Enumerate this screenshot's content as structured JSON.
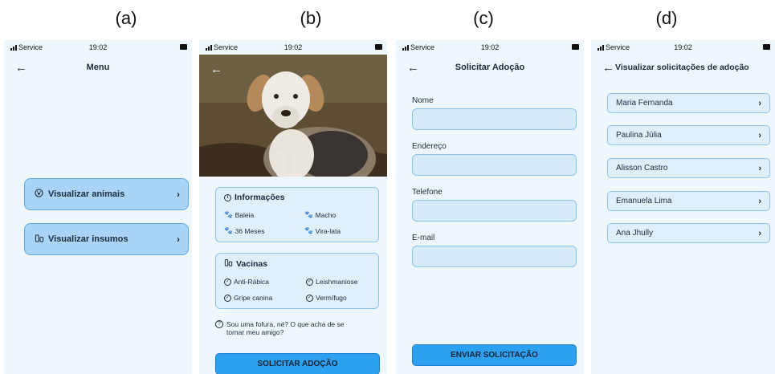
{
  "panel_labels": [
    "(a)",
    "(b)",
    "(c)",
    "(d)"
  ],
  "status": {
    "carrier": "Service",
    "time": "19:02"
  },
  "screen_a": {
    "title": "Menu",
    "buttons": [
      {
        "label": "Visualizar animais",
        "icon": "paw-circle-icon"
      },
      {
        "label": "Visualizar insumos",
        "icon": "medicine-icon"
      }
    ]
  },
  "screen_b": {
    "info": {
      "title": "Informações",
      "name": "Baleia",
      "sex": "Macho",
      "age": "36 Meses",
      "breed": "Vira-lata"
    },
    "vaccines": {
      "title": "Vacinas",
      "items": [
        "Anti-Rábica",
        "Leishmaniose",
        "Gripe canina",
        "Vermífugo"
      ]
    },
    "question": "Sou uma fofura, né? O que acha de se tornar meu amigo?",
    "button": "SOLICITAR ADOÇÃO"
  },
  "screen_c": {
    "title": "Solicitar Adoção",
    "fields": [
      "Nome",
      "Endereço",
      "Telefone",
      "E-mail"
    ],
    "button": "ENVIAR SOLICITAÇÃO"
  },
  "screen_d": {
    "title": "Visualizar solicitações de adoção",
    "requests": [
      "Maria Fernanda",
      "Paulina Júlia",
      "Alisson Castro",
      "Emanuela Lima",
      "Ana Jhully"
    ]
  },
  "colors": {
    "screen_bg": "#eef8fc",
    "accent": "#2ea0f0",
    "card_border": "#8cc3ea"
  }
}
